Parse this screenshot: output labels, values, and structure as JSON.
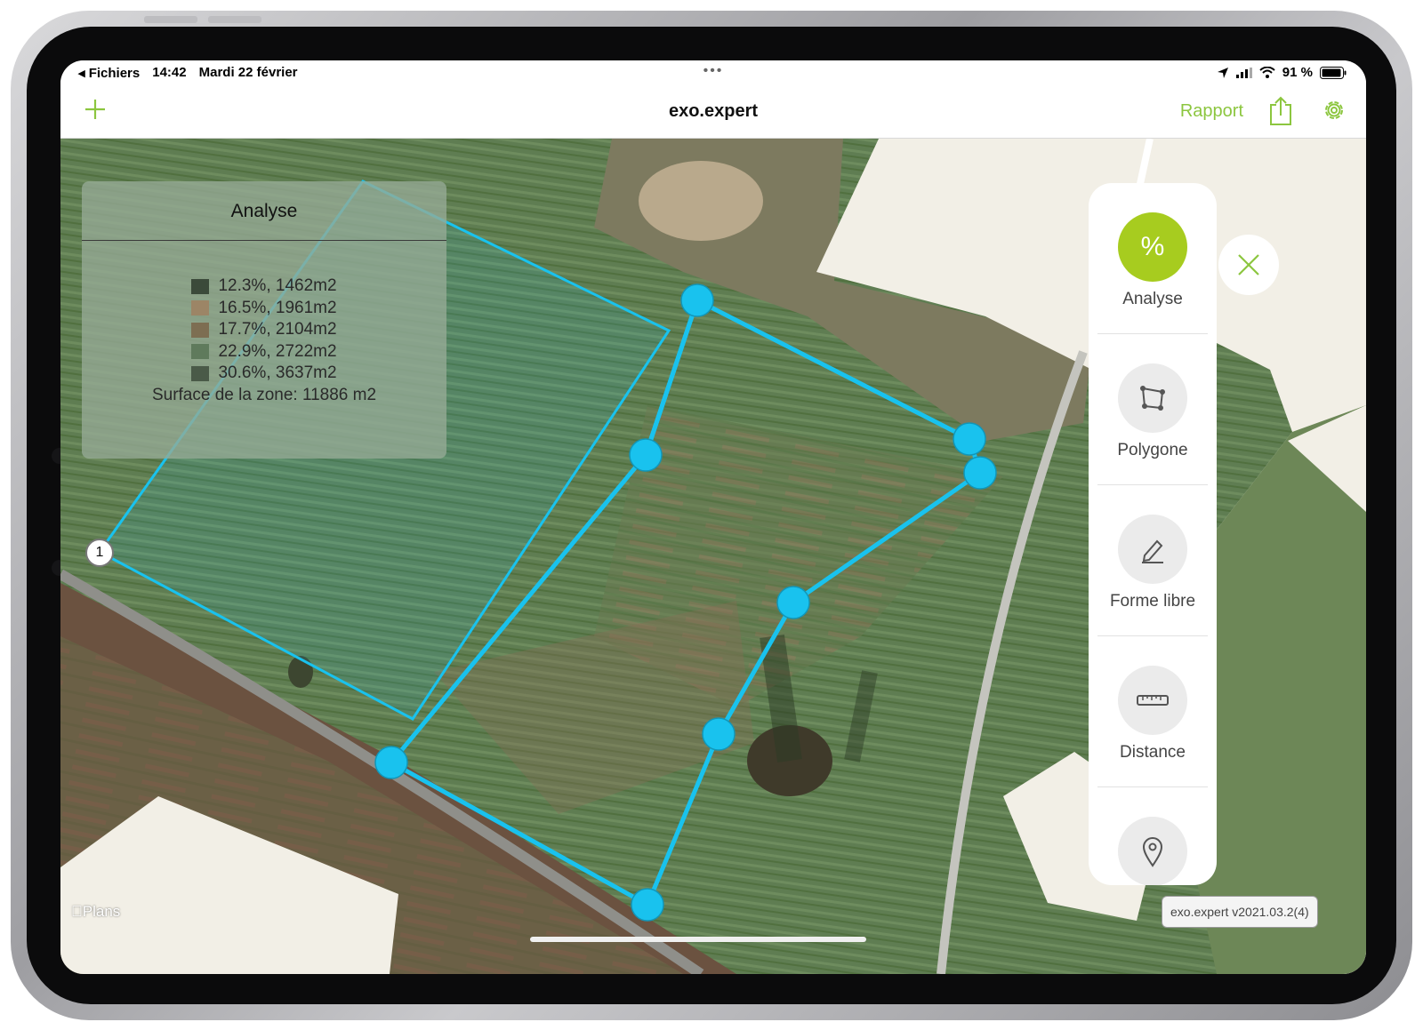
{
  "status": {
    "back_app": "◂ Fichiers",
    "time": "14:42",
    "date": "Mardi 22 février",
    "battery": "91 %",
    "dots": "•••"
  },
  "navbar": {
    "title": "exo.expert",
    "rapport_label": "Rapport"
  },
  "analyse_panel": {
    "title": "Analyse",
    "legend": [
      {
        "text": "12.3%, 1462m2",
        "color": "#3b4a3a"
      },
      {
        "text": "16.5%, 1961m2",
        "color": "#9c8566"
      },
      {
        "text": "17.7%, 2104m2",
        "color": "#7d6e52"
      },
      {
        "text": "22.9%, 2722m2",
        "color": "#5f7a5c"
      },
      {
        "text": "30.6%, 3637m2",
        "color": "#4a5a48"
      }
    ],
    "surface": "Surface de la zone: 11886 m2"
  },
  "vertex_label": "1",
  "tools": [
    {
      "label": "Analyse",
      "icon": "percent-icon",
      "glyph": "%"
    },
    {
      "label": "Polygone",
      "icon": "polygon-icon"
    },
    {
      "label": "Forme libre",
      "icon": "pencil-icon"
    },
    {
      "label": "Distance",
      "icon": "ruler-icon"
    },
    {
      "label": "",
      "icon": "map-pin-icon"
    }
  ],
  "map": {
    "attribution": "Plans",
    "version": "exo.expert v2021.03.2(4)"
  },
  "colors": {
    "accent": "#8cc63f",
    "analyse_active": "#a7cc1f",
    "polygon_stroke": "#19c2ee"
  }
}
